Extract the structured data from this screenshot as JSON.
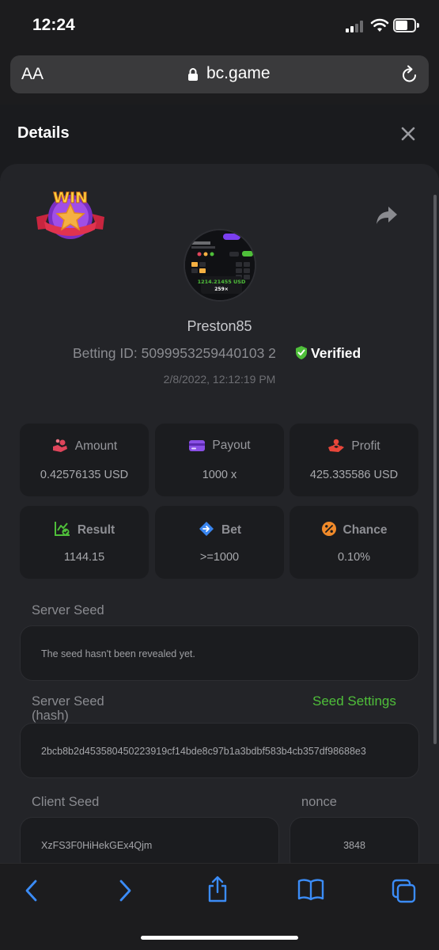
{
  "status_bar": {
    "time": "12:24"
  },
  "browser": {
    "text_size_label": "AA",
    "domain": "bc.game"
  },
  "modal": {
    "title": "Details",
    "win_badge_text": "WIN",
    "thumbnail": {
      "amount_text": "1214.21455 USD",
      "value_text": "259×"
    },
    "username": "Preston85",
    "betting_id_label": "Betting ID:",
    "betting_id": "5099953259440103 2",
    "verified_label": "Verified",
    "date": "2/8/2022, 12:12:19 PM"
  },
  "stats": [
    {
      "label": "Amount",
      "value": "0.42576135 USD",
      "icon": "hand-coins-icon",
      "color": "#e0455b"
    },
    {
      "label": "Payout",
      "value": "1000 x",
      "icon": "card-icon",
      "color": "#8a4fe6"
    },
    {
      "label": "Profit",
      "value": "425.335586 USD",
      "icon": "hand-person-icon",
      "color": "#e8463a"
    },
    {
      "label": "Result",
      "value": "1144.15",
      "icon": "chart-check-icon",
      "color": "#4fbf3a"
    },
    {
      "label": "Bet",
      "value": ">=1000",
      "icon": "diamond-arrow-icon",
      "color": "#3a86f0"
    },
    {
      "label": "Chance",
      "value": "0.10%",
      "icon": "percent-icon",
      "color": "#f08a2a"
    }
  ],
  "server_seed": {
    "label": "Server Seed",
    "value": "The seed hasn't been revealed yet."
  },
  "server_seed_hash": {
    "label_line1": "Server Seed",
    "label_line2": "(hash)",
    "settings_link": "Seed Settings",
    "value": "2bcb8b2d453580450223919cf14bde8c97b1a3bdbf583b4cb357df98688e3"
  },
  "client_seed": {
    "label": "Client Seed",
    "value": "XzFS3F0HiHekGEx4Qjm"
  },
  "nonce": {
    "label": "nonce",
    "value": "3848"
  }
}
